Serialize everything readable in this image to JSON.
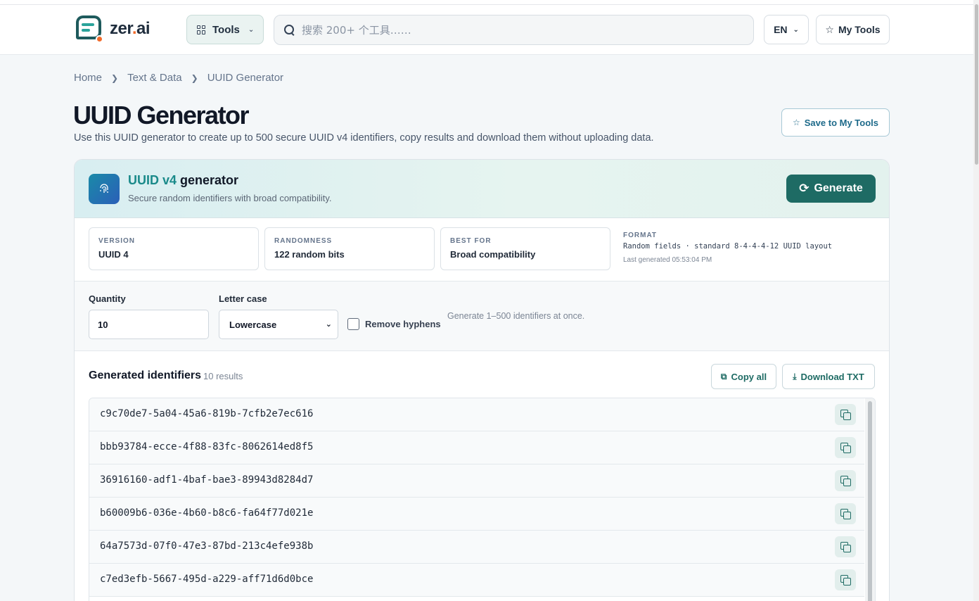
{
  "header": {
    "logo_text_main": "zer",
    "logo_text_dot": ".",
    "logo_text_end": "ai",
    "tools_label": "Tools",
    "search_placeholder": "搜索 200+ 个工具……",
    "lang_label": "EN",
    "my_tools_label": "My Tools"
  },
  "breadcrumb": {
    "items": [
      "Home",
      "Text & Data",
      "UUID Generator"
    ]
  },
  "page": {
    "title": "UUID Generator",
    "description": "Use this UUID generator to create up to 500 secure UUID v4 identifiers, copy results and download them without uploading data.",
    "save_label": "Save to My Tools"
  },
  "generator": {
    "title_highlight": "UUID v4",
    "title_rest": " generator",
    "subtitle": "Secure random identifiers with broad compatibility.",
    "generate_label": "Generate"
  },
  "meta": {
    "version_label": "VERSION",
    "version_value": "UUID 4",
    "randomness_label": "RANDOMNESS",
    "randomness_value": "122 random bits",
    "best_for_label": "BEST FOR",
    "best_for_value": "Broad compatibility",
    "format_label": "FORMAT",
    "format_value": "Random fields · standard 8-4-4-4-12 UUID layout",
    "last_generated": "Last generated 05:53:04 PM"
  },
  "controls": {
    "quantity_label": "Quantity",
    "quantity_value": "10",
    "case_label": "Letter case",
    "case_value": "Lowercase",
    "hyphen_label": "Remove hyphens",
    "hint": "Generate 1–500 identifiers at once."
  },
  "results": {
    "title": "Generated identifiers",
    "count": "10 results",
    "copy_all_label": "Copy all",
    "download_label": "Download TXT",
    "items": [
      "c9c70de7-5a04-45a6-819b-7cfb2e7ec616",
      "bbb93784-ecce-4f88-83fc-8062614ed8f5",
      "36916160-adf1-4baf-bae3-89943d8284d7",
      "b60009b6-036e-4b60-b8c6-fa64f77d021e",
      "64a7573d-07f0-47e3-87bd-213c4efe938b",
      "c7ed3efb-5667-495d-a229-aff71d6d0bce"
    ]
  },
  "colors": {
    "accent": "#1e6b64",
    "brand_orange": "#f26b2a",
    "teal_highlight": "#1a8a8a"
  }
}
